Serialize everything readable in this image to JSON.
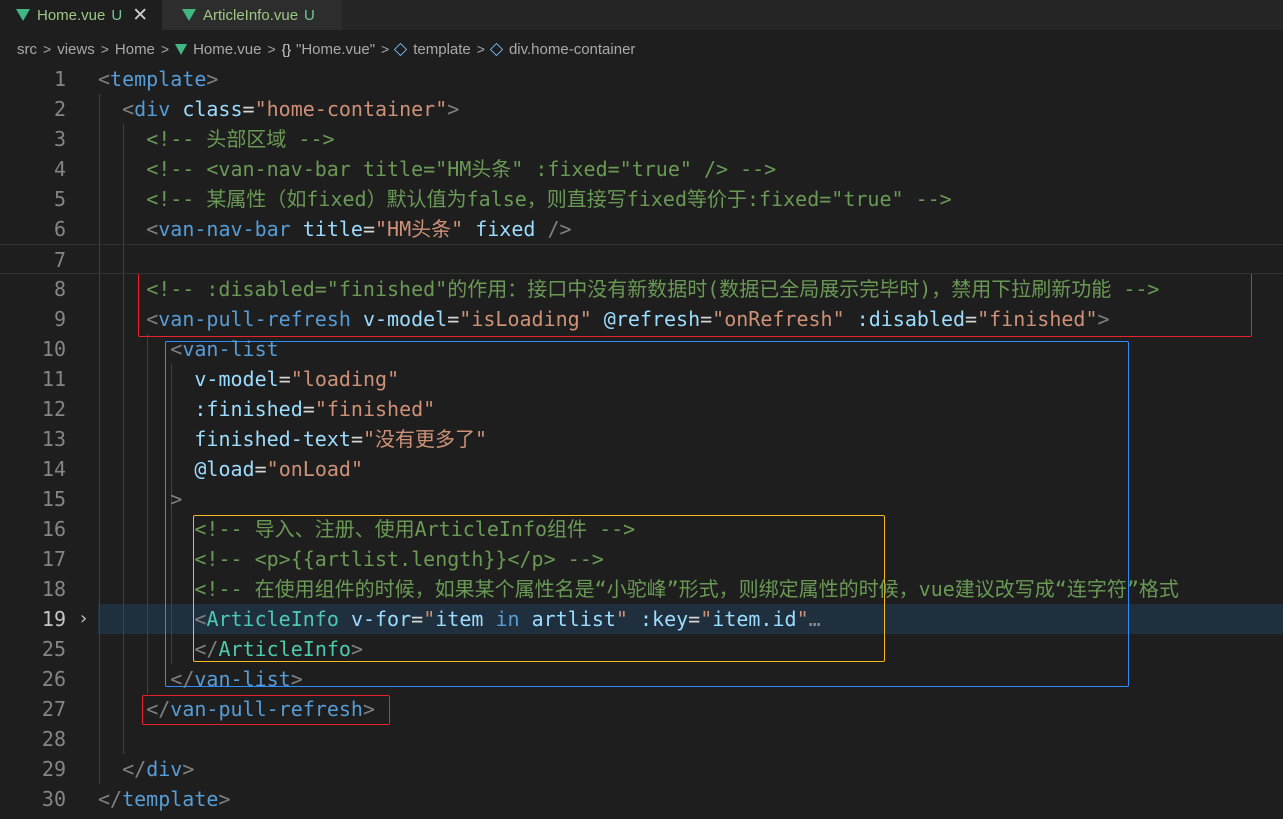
{
  "tabs": [
    {
      "label": "Home.vue",
      "badge": "U",
      "close": "✕"
    },
    {
      "label": "ArticleInfo.vue",
      "badge": "U"
    }
  ],
  "breadcrumb": [
    "src",
    "views",
    "Home",
    "Home.vue",
    "\"Home.vue\"",
    "template",
    "div.home-container"
  ],
  "breadcrumb_sep": ">",
  "braces_glyph": "{}",
  "folded_ellipsis": "…",
  "lines": [
    {
      "num": "1",
      "indent": 0,
      "tokens": [
        [
          "p",
          "<"
        ],
        [
          "tag",
          "template"
        ],
        [
          "p",
          ">"
        ]
      ]
    },
    {
      "num": "2",
      "indent": 1,
      "tokens": [
        [
          "p",
          "<"
        ],
        [
          "tag",
          "div"
        ],
        [
          "txt",
          " "
        ],
        [
          "attr",
          "class"
        ],
        [
          "txt",
          "="
        ],
        [
          "str",
          "\"home-container\""
        ],
        [
          "p",
          ">"
        ]
      ]
    },
    {
      "num": "3",
      "indent": 2,
      "tokens": [
        [
          "com",
          "<!-- 头部区域 -->"
        ]
      ]
    },
    {
      "num": "4",
      "indent": 2,
      "tokens": [
        [
          "com",
          "<!-- <van-nav-bar title=\"HM头条\" :fixed=\"true\" /> -->"
        ]
      ]
    },
    {
      "num": "5",
      "indent": 2,
      "tokens": [
        [
          "com",
          "<!-- 某属性（如fixed）默认值为false，则直接写fixed等价于:fixed=\"true\" -->"
        ]
      ]
    },
    {
      "num": "6",
      "indent": 2,
      "tokens": [
        [
          "p",
          "<"
        ],
        [
          "tag",
          "van-nav-bar"
        ],
        [
          "txt",
          " "
        ],
        [
          "attr",
          "title"
        ],
        [
          "txt",
          "="
        ],
        [
          "str",
          "\"HM头条\""
        ],
        [
          "txt",
          " "
        ],
        [
          "attr",
          "fixed"
        ],
        [
          "txt",
          " "
        ],
        [
          "p",
          "/>"
        ]
      ]
    },
    {
      "num": "7",
      "indent": 0,
      "tokens": []
    },
    {
      "num": "8",
      "indent": 2,
      "tokens": [
        [
          "com",
          "<!-- :disabled=\"finished\"的作用：接口中没有新数据时(数据已全局展示完毕时)，禁用下拉刷新功能 -->"
        ]
      ]
    },
    {
      "num": "9",
      "indent": 2,
      "tokens": [
        [
          "p",
          "<"
        ],
        [
          "tag",
          "van-pull-refresh"
        ],
        [
          "txt",
          " "
        ],
        [
          "attr",
          "v-model"
        ],
        [
          "txt",
          "="
        ],
        [
          "str",
          "\"isLoading\""
        ],
        [
          "txt",
          " "
        ],
        [
          "attr",
          "@refresh"
        ],
        [
          "txt",
          "="
        ],
        [
          "str",
          "\"onRefresh\""
        ],
        [
          "txt",
          " "
        ],
        [
          "attr",
          ":disabled"
        ],
        [
          "txt",
          "="
        ],
        [
          "str",
          "\"finished\""
        ],
        [
          "p",
          ">"
        ]
      ]
    },
    {
      "num": "10",
      "indent": 3,
      "tokens": [
        [
          "p",
          "<"
        ],
        [
          "tag",
          "van-list"
        ]
      ]
    },
    {
      "num": "11",
      "indent": 4,
      "tokens": [
        [
          "attr",
          "v-model"
        ],
        [
          "txt",
          "="
        ],
        [
          "str",
          "\"loading\""
        ]
      ]
    },
    {
      "num": "12",
      "indent": 4,
      "tokens": [
        [
          "attr",
          ":finished"
        ],
        [
          "txt",
          "="
        ],
        [
          "str",
          "\"finished\""
        ]
      ]
    },
    {
      "num": "13",
      "indent": 4,
      "tokens": [
        [
          "attr",
          "finished-text"
        ],
        [
          "txt",
          "="
        ],
        [
          "str",
          "\"没有更多了\""
        ]
      ]
    },
    {
      "num": "14",
      "indent": 4,
      "tokens": [
        [
          "attr",
          "@load"
        ],
        [
          "txt",
          "="
        ],
        [
          "str",
          "\"onLoad\""
        ]
      ]
    },
    {
      "num": "15",
      "indent": 3,
      "tokens": [
        [
          "p",
          ">"
        ]
      ]
    },
    {
      "num": "16",
      "indent": 4,
      "tokens": [
        [
          "com",
          "<!-- 导入、注册、使用ArticleInfo组件 -->"
        ]
      ]
    },
    {
      "num": "17",
      "indent": 4,
      "tokens": [
        [
          "com",
          "<!-- <p>{{artlist.length}}</p> -->"
        ]
      ]
    },
    {
      "num": "18",
      "indent": 4,
      "tokens": [
        [
          "com",
          "<!-- 在使用组件的时候，如果某个属性名是“小驼峰”形式，则绑定属性的时候，vue建议改写成“连字符”格式"
        ]
      ]
    },
    {
      "num": "19",
      "indent": 4,
      "tokens": [
        [
          "p",
          "<"
        ],
        [
          "comp",
          "ArticleInfo"
        ],
        [
          "txt",
          " "
        ],
        [
          "attr",
          "v-for"
        ],
        [
          "txt",
          "="
        ],
        [
          "str",
          "\""
        ],
        [
          "attr",
          "item"
        ],
        [
          "txt",
          " "
        ],
        [
          "kw",
          "in"
        ],
        [
          "txt",
          " "
        ],
        [
          "attr",
          "artlist"
        ],
        [
          "str",
          "\""
        ],
        [
          "txt",
          " "
        ],
        [
          "attr",
          ":key"
        ],
        [
          "txt",
          "="
        ],
        [
          "str",
          "\""
        ],
        [
          "attr",
          "item.id"
        ],
        [
          "str",
          "\""
        ]
      ],
      "folded": true
    },
    {
      "num": "25",
      "indent": 4,
      "tokens": [
        [
          "p",
          "</"
        ],
        [
          "comp",
          "ArticleInfo"
        ],
        [
          "p",
          ">"
        ]
      ]
    },
    {
      "num": "26",
      "indent": 3,
      "tokens": [
        [
          "p",
          "</"
        ],
        [
          "tag",
          "van-list"
        ],
        [
          "p",
          ">"
        ]
      ]
    },
    {
      "num": "27",
      "indent": 2,
      "tokens": [
        [
          "p",
          "</"
        ],
        [
          "tag",
          "van-pull-refresh"
        ],
        [
          "p",
          ">"
        ]
      ]
    },
    {
      "num": "28",
      "indent": 0,
      "tokens": []
    },
    {
      "num": "29",
      "indent": 1,
      "tokens": [
        [
          "p",
          "</"
        ],
        [
          "tag",
          "div"
        ],
        [
          "p",
          ">"
        ]
      ]
    },
    {
      "num": "30",
      "indent": 0,
      "tokens": [
        [
          "p",
          "</"
        ],
        [
          "tag",
          "template"
        ],
        [
          "p",
          ">"
        ]
      ]
    }
  ],
  "colors": {
    "annotation_red": "#e8212c",
    "annotation_blue": "#2f8cff",
    "annotation_yellow": "#f5b921",
    "vue_green": "#41b883"
  }
}
